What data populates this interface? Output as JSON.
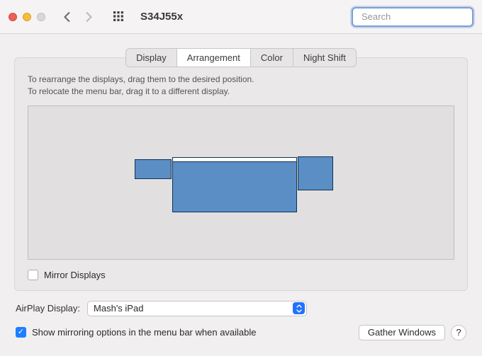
{
  "window": {
    "title": "S34J55x",
    "search_placeholder": "Search"
  },
  "tabs": {
    "items": [
      "Display",
      "Arrangement",
      "Color",
      "Night Shift"
    ],
    "active_index": 1
  },
  "arrangement": {
    "instruction_line1": "To rearrange the displays, drag them to the desired position.",
    "instruction_line2": "To relocate the menu bar, drag it to a different display.",
    "mirror_label": "Mirror Displays",
    "mirror_checked": false,
    "displays": [
      {
        "id": "left",
        "has_menubar": false
      },
      {
        "id": "main",
        "has_menubar": true
      },
      {
        "id": "right",
        "has_menubar": false
      }
    ]
  },
  "airplay": {
    "label": "AirPlay Display:",
    "selected": "Mash's iPad"
  },
  "options": {
    "show_mirroring_label": "Show mirroring options in the menu bar when available",
    "show_mirroring_checked": true
  },
  "buttons": {
    "gather_windows": "Gather Windows",
    "help": "?"
  }
}
